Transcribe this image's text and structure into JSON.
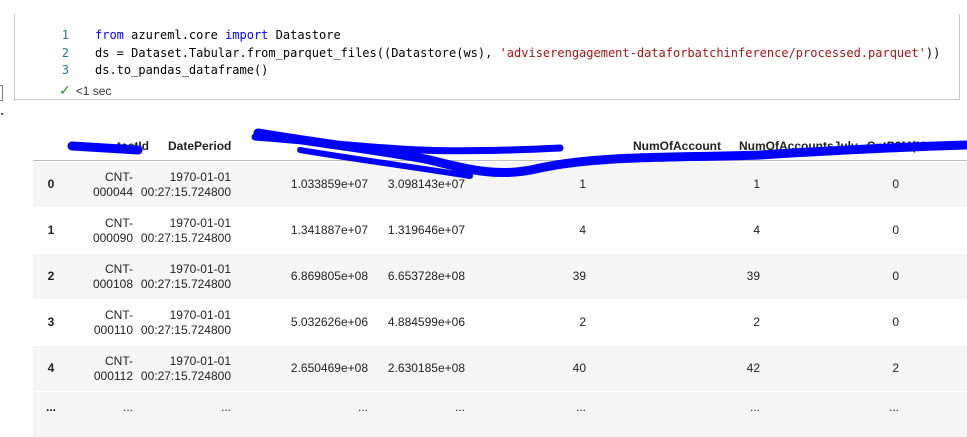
{
  "code_cell": {
    "lines": [
      {
        "n": "1",
        "parts": [
          [
            "kw",
            "from"
          ],
          [
            "tx",
            " azureml.core "
          ],
          [
            "kw",
            "import"
          ],
          [
            "tx",
            " Datastore"
          ]
        ]
      },
      {
        "n": "2",
        "parts": [
          [
            "tx",
            "ds = Dataset.Tabular.from_parquet_files((Datastore(ws), "
          ],
          [
            "str",
            "'adviserengagement-dataforbatchinference/processed.parquet'"
          ],
          [
            "tx",
            "))"
          ]
        ]
      },
      {
        "n": "3",
        "parts": [
          [
            "tx",
            "ds.to_pandas_dataframe()"
          ]
        ]
      }
    ],
    "exec_time": "<1 sec"
  },
  "table": {
    "headers": [
      {
        "id": "contactid",
        "label": "...tactId"
      },
      {
        "id": "dateperiod",
        "label": "DatePeriod"
      },
      {
        "id": "col6",
        "label": "NumOfAccount"
      },
      {
        "id": "col7",
        "label": "NumOfAccountsJuly...CntP3M(M"
      }
    ],
    "rows": [
      {
        "index": "0",
        "id1": "CNT-",
        "id2": "000044",
        "d1": "1970-01-01",
        "d2": "00:27:15.724800",
        "v1": "1.033859e+07",
        "v2": "3.098143e+07",
        "v3": "1",
        "v4": "1",
        "v5": "0"
      },
      {
        "index": "1",
        "id1": "CNT-",
        "id2": "000090",
        "d1": "1970-01-01",
        "d2": "00:27:15.724800",
        "v1": "1.341887e+07",
        "v2": "1.319646e+07",
        "v3": "4",
        "v4": "4",
        "v5": "0"
      },
      {
        "index": "2",
        "id1": "CNT-",
        "id2": "000108",
        "d1": "1970-01-01",
        "d2": "00:27:15.724800",
        "v1": "6.869805e+08",
        "v2": "6.653728e+08",
        "v3": "39",
        "v4": "39",
        "v5": "0"
      },
      {
        "index": "3",
        "id1": "CNT-",
        "id2": "000110",
        "d1": "1970-01-01",
        "d2": "00:27:15.724800",
        "v1": "5.032626e+06",
        "v2": "4.884599e+06",
        "v3": "2",
        "v4": "2",
        "v5": "0"
      },
      {
        "index": "4",
        "id1": "CNT-",
        "id2": "000112",
        "d1": "1970-01-01",
        "d2": "00:27:15.724800",
        "v1": "2.650469e+08",
        "v2": "2.630185e+08",
        "v3": "40",
        "v4": "42",
        "v5": "2"
      }
    ],
    "ellipsis_row": {
      "index": "...",
      "cell": "..."
    }
  },
  "colors": {
    "redaction": "#0000ff",
    "check": "#388a34",
    "keyword": "#0000ff",
    "string": "#a31515",
    "line_number": "#237893"
  }
}
